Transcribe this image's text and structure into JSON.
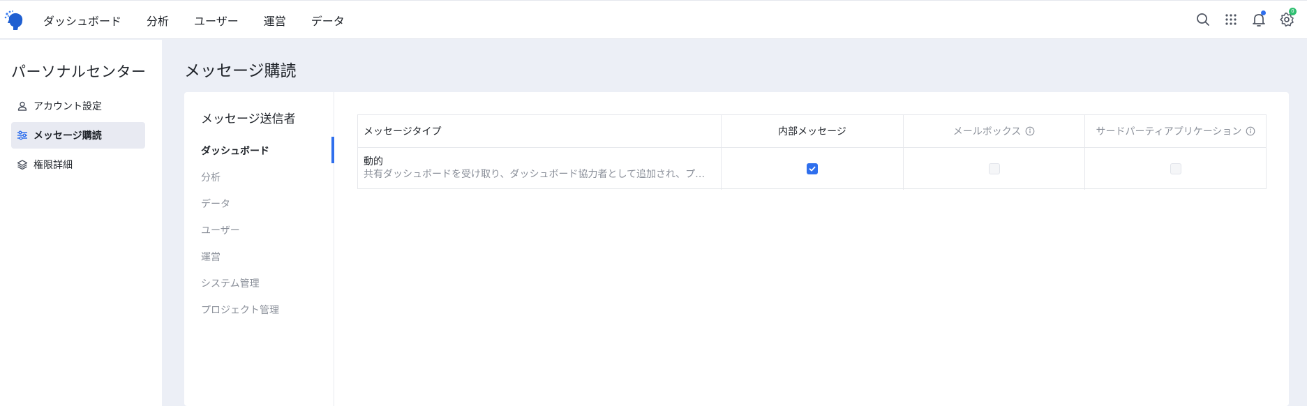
{
  "topbar": {
    "nav": [
      "ダッシュボード",
      "分析",
      "ユーザー",
      "運営",
      "データ"
    ],
    "icons": [
      "search-icon",
      "apps-grid-icon",
      "bell-icon",
      "settings-icon"
    ],
    "settings_badge": "0",
    "accent": "#2f6fed"
  },
  "sidebar": {
    "title": "パーソナルセンター",
    "items": [
      {
        "label": "アカウント設定",
        "icon": "user-icon",
        "active": false
      },
      {
        "label": "メッセージ購読",
        "icon": "sliders-icon",
        "active": true
      },
      {
        "label": "権限詳細",
        "icon": "layers-icon",
        "active": false
      }
    ]
  },
  "main": {
    "title": "メッセージ購読",
    "sender_title": "メッセージ送信者",
    "senders": [
      "ダッシュボード",
      "分析",
      "データ",
      "ユーザー",
      "運営",
      "システム管理",
      "プロジェクト管理"
    ],
    "active_sender": "ダッシュボード",
    "table": {
      "headers": [
        "メッセージタイプ",
        "内部メッセージ",
        "メールボックス",
        "サードパーティアプリケーション"
      ],
      "rows": [
        {
          "type": "動的",
          "description": "共有ダッシュボードを受け取り、ダッシュボード協力者として追加され、プロ...",
          "internal": true,
          "mailbox": false,
          "third_party": false
        }
      ]
    }
  }
}
